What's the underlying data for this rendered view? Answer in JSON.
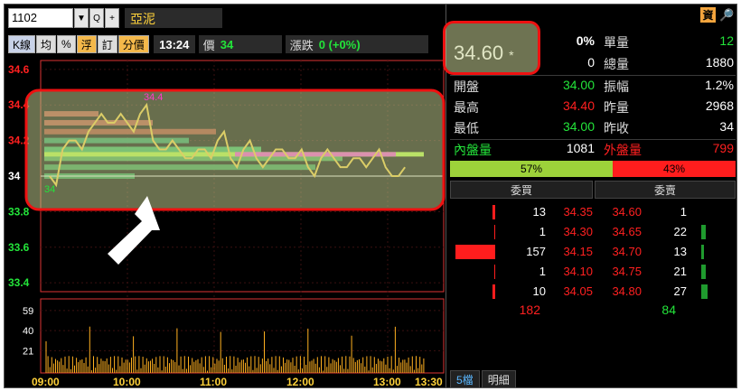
{
  "toolbar": {
    "code": "1102",
    "dropdown_glyph": "▼",
    "search_glyph": "Q",
    "add_glyph": "+",
    "stock_name": "亞泥"
  },
  "modes": [
    "K線",
    "均",
    "%",
    "浮",
    "訂",
    "分價"
  ],
  "status": {
    "time": "13:24",
    "price_label": "價",
    "price_value": "34",
    "change_label": "漲跌",
    "change_value": "0 (+0%)"
  },
  "chart": {
    "y_ticks": [
      "34.6",
      "34.4",
      "34.2",
      "34",
      "33.8",
      "33.6",
      "33.4"
    ],
    "vol_ticks": [
      "59",
      "40",
      "21"
    ],
    "x_ticks": [
      "09:00",
      "10:00",
      "11:00",
      "12:00",
      "13:00",
      "13:30"
    ],
    "annot_high": "34.4",
    "annot_low": "34",
    "colors": {
      "up": "#ff2020",
      "down": "#23e43a",
      "flat": "#ffffff",
      "line": "#ffd23a",
      "callout": "#e11"
    }
  },
  "chart_data": {
    "type": "line",
    "title": "",
    "xlabel": "",
    "ylabel": "",
    "x": [
      "09:00",
      "09:10",
      "09:20",
      "09:30",
      "09:40",
      "09:50",
      "10:00",
      "10:10",
      "10:20",
      "10:30",
      "10:40",
      "10:50",
      "11:00",
      "11:10",
      "11:20",
      "11:30",
      "11:40",
      "11:50",
      "12:00",
      "12:10",
      "12:20",
      "12:30",
      "12:40",
      "12:50",
      "13:00",
      "13:10",
      "13:20",
      "13:24"
    ],
    "series": [
      {
        "values": [
          34.0,
          34.15,
          34.2,
          34.25,
          34.35,
          34.3,
          34.3,
          34.35,
          34.2,
          34.15,
          34.15,
          34.1,
          34.15,
          34.2,
          34.1,
          34.15,
          34.1,
          34.1,
          34.15,
          34.1,
          34.05,
          34.1,
          34.1,
          34.05,
          34.1,
          34.1,
          34.05,
          34.0
        ]
      }
    ],
    "ylim": [
      33.35,
      34.65
    ],
    "volume_ylim": [
      0,
      70
    ],
    "grid": true
  },
  "quote": {
    "info_glyph": "資",
    "search_glyph": "🔎",
    "big_price": "34.60",
    "big_star": "*",
    "pct": "0%",
    "zero": "0",
    "single_vol_label": "單量",
    "single_vol": "12",
    "total_vol_label": "總量",
    "total_vol": "1880",
    "open_label": "開盤",
    "open": "34.00",
    "amplitude_label": "振幅",
    "amplitude": "1.2%",
    "high_label": "最高",
    "high": "34.40",
    "prev_vol_label": "昨量",
    "prev_vol": "2968",
    "low_label": "最低",
    "low": "34.00",
    "prev_close_label": "昨收",
    "prev_close": "34",
    "inner_label": "內盤量",
    "inner": "1081",
    "outer_label": "外盤量",
    "outer": "799",
    "buy_ratio": "57%",
    "sell_ratio": "43%",
    "buy_ratio_value": 57,
    "bid_head": "委買",
    "ask_head": "委賣",
    "book": [
      {
        "bid_vol": "13",
        "bid": "34.35",
        "ask": "34.60",
        "ask_vol": "1",
        "bid_bar": 3,
        "ask_bar": 0
      },
      {
        "bid_vol": "1",
        "bid": "34.30",
        "ask": "34.65",
        "ask_vol": "22",
        "bid_bar": 1,
        "ask_bar": 5
      },
      {
        "bid_vol": "157",
        "bid": "34.15",
        "ask": "34.70",
        "ask_vol": "13",
        "bid_bar": 44,
        "ask_bar": 3
      },
      {
        "bid_vol": "1",
        "bid": "34.10",
        "ask": "34.75",
        "ask_vol": "21",
        "bid_bar": 1,
        "ask_bar": 5
      },
      {
        "bid_vol": "10",
        "bid": "34.05",
        "ask": "34.80",
        "ask_vol": "27",
        "bid_bar": 3,
        "ask_bar": 7
      }
    ],
    "bid_total": "182",
    "ask_total": "84"
  },
  "tabs": [
    "5檔",
    "明細"
  ]
}
